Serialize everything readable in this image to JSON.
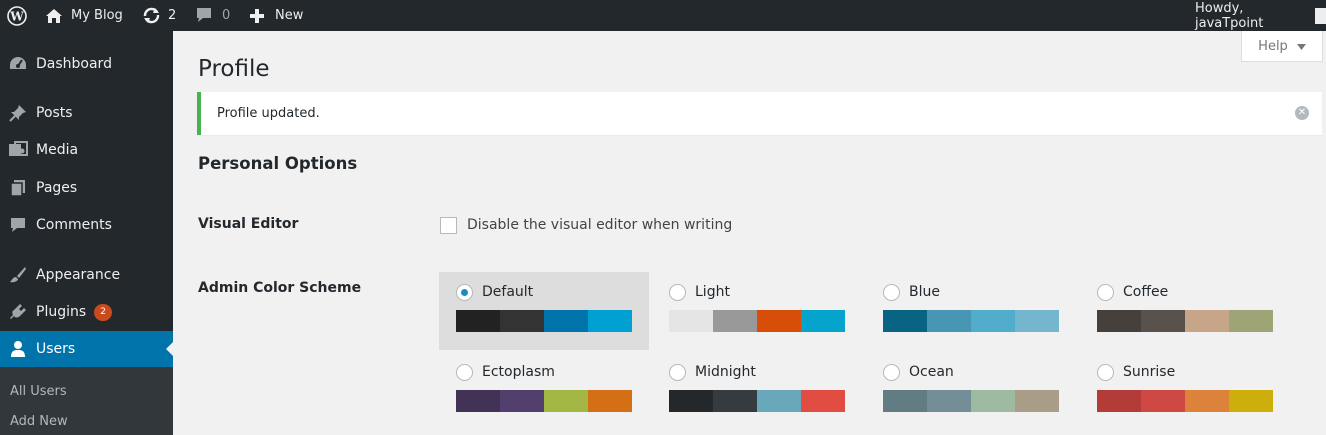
{
  "adminbar": {
    "site_name": "My Blog",
    "updates_count": "2",
    "comments_count": "0",
    "new_label": "New",
    "howdy": "Howdy, javaTpoint"
  },
  "sidebar": {
    "items": [
      {
        "label": "Dashboard",
        "icon": "dashboard-icon"
      },
      {
        "label": "Posts",
        "icon": "pushpin-icon"
      },
      {
        "label": "Media",
        "icon": "media-icon"
      },
      {
        "label": "Pages",
        "icon": "pages-icon"
      },
      {
        "label": "Comments",
        "icon": "comment-icon"
      },
      {
        "label": "Appearance",
        "icon": "paintbrush-icon"
      },
      {
        "label": "Plugins",
        "icon": "plugin-icon",
        "badge": "2"
      },
      {
        "label": "Users",
        "icon": "user-icon"
      }
    ],
    "submenu": [
      {
        "label": "All Users"
      },
      {
        "label": "Add New"
      }
    ]
  },
  "help_label": "Help",
  "page_title": "Profile",
  "notice": "Profile updated.",
  "personal_options": {
    "title": "Personal Options",
    "visual_editor_label": "Visual Editor",
    "visual_editor_checkbox": "Disable the visual editor when writing",
    "color_scheme_label": "Admin Color Scheme"
  },
  "color_schemes": [
    {
      "name": "Default",
      "selected": true,
      "colors": [
        "#222222",
        "#333333",
        "#0073aa",
        "#00a0d2"
      ]
    },
    {
      "name": "Light",
      "selected": false,
      "colors": [
        "#e5e5e5",
        "#999999",
        "#d64e07",
        "#04a4cc"
      ]
    },
    {
      "name": "Blue",
      "selected": false,
      "colors": [
        "#096484",
        "#4796b3",
        "#52accc",
        "#74b6ce"
      ]
    },
    {
      "name": "Coffee",
      "selected": false,
      "colors": [
        "#46403c",
        "#59524c",
        "#c7a589",
        "#9ea476"
      ]
    },
    {
      "name": "Ectoplasm",
      "selected": false,
      "colors": [
        "#413256",
        "#523f6d",
        "#a3b745",
        "#d46f15"
      ]
    },
    {
      "name": "Midnight",
      "selected": false,
      "colors": [
        "#25282b",
        "#363b3f",
        "#69a8bb",
        "#e14d43"
      ]
    },
    {
      "name": "Ocean",
      "selected": false,
      "colors": [
        "#627c83",
        "#738e96",
        "#9ebaa0",
        "#aa9d88"
      ]
    },
    {
      "name": "Sunrise",
      "selected": false,
      "colors": [
        "#b43c38",
        "#cf4944",
        "#dd823b",
        "#ccaf0b"
      ]
    }
  ]
}
